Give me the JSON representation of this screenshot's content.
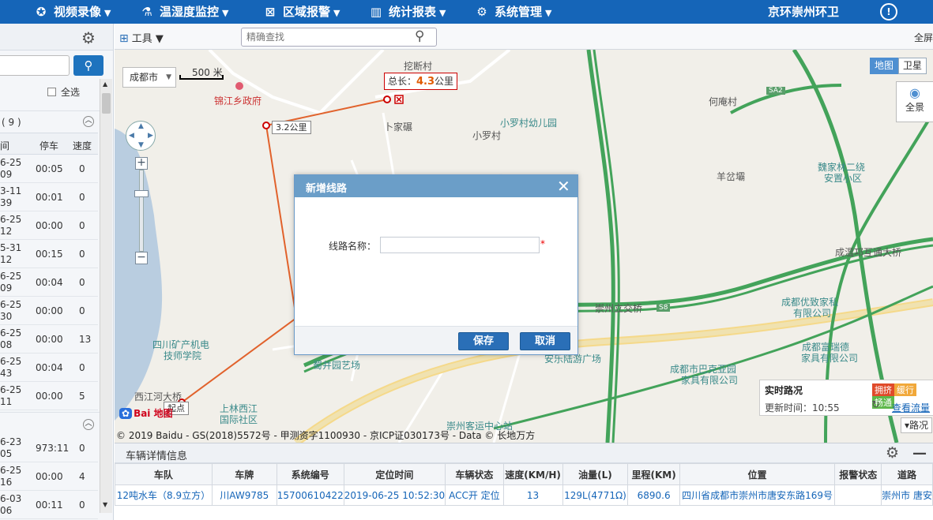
{
  "nav": {
    "items": [
      {
        "label": "视频录像",
        "icon": "video-icon"
      },
      {
        "label": "温湿度监控",
        "icon": "thermometer-icon"
      },
      {
        "label": "区域报警",
        "icon": "area-alarm-icon"
      },
      {
        "label": "统计报表",
        "icon": "chart-icon"
      },
      {
        "label": "系统管理",
        "icon": "settings-doc-icon"
      }
    ],
    "company": "京环崇州环卫",
    "accent_color": "#1565b8"
  },
  "left_panel": {
    "select_all": "全选",
    "group1_count": "( 9 )",
    "columns": {
      "time": "间",
      "stop": "停车",
      "speed": "速度"
    },
    "rows": [
      {
        "d1": "6-25",
        "d2": "09",
        "stop": "00:05",
        "speed": "0"
      },
      {
        "d1": "3-11",
        "d2": "39",
        "stop": "00:01",
        "speed": "0"
      },
      {
        "d1": "6-25",
        "d2": "12",
        "stop": "00:00",
        "speed": "0"
      },
      {
        "d1": "5-31",
        "d2": "12",
        "stop": "00:15",
        "speed": "0"
      },
      {
        "d1": "6-25",
        "d2": "09",
        "stop": "00:04",
        "speed": "0"
      },
      {
        "d1": "6-25",
        "d2": "30",
        "stop": "00:00",
        "speed": "0"
      },
      {
        "d1": "6-25",
        "d2": "08",
        "stop": "00:00",
        "speed": "13"
      },
      {
        "d1": "6-25",
        "d2": "43",
        "stop": "00:04",
        "speed": "0"
      },
      {
        "d1": "6-25",
        "d2": "11",
        "stop": "00:00",
        "speed": "5"
      },
      {
        "d1": "6-23",
        "d2": "05",
        "stop": "973:11",
        "speed": "0"
      },
      {
        "d1": "6-25",
        "d2": "16",
        "stop": "00:00",
        "speed": "4"
      },
      {
        "d1": "6-03",
        "d2": "06",
        "stop": "00:11",
        "speed": "0"
      }
    ]
  },
  "toolbar": {
    "tools_label": "工具",
    "search_placeholder": "精确查找",
    "fullscreen": "全屏"
  },
  "map": {
    "city": "成都市",
    "scale": "500 米",
    "total_prefix": "总长：",
    "total_value": "4.3",
    "total_unit": "公里",
    "segment_distance": "3.2公里",
    "start_label": "起点",
    "labels": {
      "jinjiang_gov": "锦江乡政府",
      "waduan": "挖断村",
      "bujiaxie": "卜家碾",
      "xiaoluo_kinder": "小罗村幼儿园",
      "xiaoluo": "小罗村",
      "heyan": "何庵村",
      "yangcaoba": "羊岔壩",
      "weijialin1": "魏家林二绕",
      "weijialin2": "安置小区",
      "chengwen": "成温邛互通大桥",
      "chongzhou_bridge": "崇州立交桥",
      "youzhi1": "成都优致家私",
      "youzhi2": "有限公司",
      "fuliuide1": "成都富瑞德",
      "fuliuide2": "家具有限公司",
      "bakeya1": "成都市巴克亚园",
      "bakeya2": "家具有限公司",
      "kuangchan1": "四川矿产机电",
      "kuangchan2": "技师学院",
      "shujingyuan": "蜀井园艺场",
      "anle": "安乐陆游广场",
      "xijianghe": "西江河大桥",
      "shanglin1": "上林西江",
      "shanglin2": "国际社区",
      "keyun": "崇州客运中心站",
      "road_sa2": "SA2",
      "road_s8": "S8"
    },
    "map_type": {
      "map": "地图",
      "satellite": "卫星"
    },
    "panorama": "全景",
    "traffic": {
      "title": "实时路况",
      "jam": "拥挤",
      "slow": "缓行",
      "smooth": "畅通",
      "update_prefix": "更新时间：",
      "update_time": "10:55",
      "view_flow": "查看流量"
    },
    "road_btn": "路况",
    "baidu_logo": "Bai 地图",
    "copyright": "© 2019 Baidu - GS(2018)5572号 - 甲测资字1100930 - 京ICP证030173号 - Data © 长地万方"
  },
  "bottom": {
    "title": "车辆详情信息",
    "columns": [
      "车队",
      "车牌",
      "系统编号",
      "定位时间",
      "车辆状态",
      "速度(KM/H)",
      "油量(L)",
      "里程(KM)",
      "位置",
      "报警状态",
      "道路"
    ],
    "rows": [
      [
        "12吨水车（8.9立方）",
        "川AW9785",
        "15700610422",
        "2019-06-25 10:52:30",
        "ACC开 定位",
        "13",
        "129L(4771Ω)",
        "6890.6",
        "四川省成都市崇州市唐安东路169号",
        "",
        "崇州市 唐安"
      ]
    ]
  },
  "modal": {
    "title": "新增线路",
    "field_label": "线路名称：",
    "required_mark": "*",
    "save": "保存",
    "cancel": "取消"
  }
}
